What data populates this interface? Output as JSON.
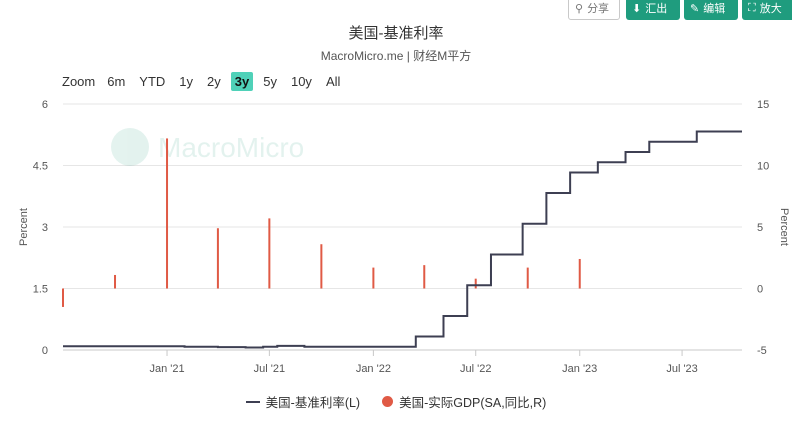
{
  "toolbar": {
    "share_label": "分享",
    "export_label": "汇出",
    "edit_label": "编辑",
    "zoom_label": "放大",
    "accent": "#1f9c7e"
  },
  "title": "美国-基准利率",
  "subtitle": "MacroMicro.me | 财经M平方",
  "watermark": "MacroMicro",
  "zoom": {
    "label": "Zoom",
    "options": [
      "6m",
      "YTD",
      "1y",
      "2y",
      "3y",
      "5y",
      "10y",
      "All"
    ],
    "active": "3y"
  },
  "chart_data": {
    "type": "line",
    "title": "美国-基准利率",
    "x_ticks": [
      "Jan '21",
      "Jul '21",
      "Jan '22",
      "Jul '22",
      "Jan '23",
      "Jul '23"
    ],
    "x_range": [
      "2020-07-01",
      "2023-10-15"
    ],
    "left_axis": {
      "label": "Percent",
      "ticks": [
        "0",
        "1.5",
        "3",
        "4.5",
        "6"
      ],
      "range": [
        0,
        6
      ]
    },
    "right_axis": {
      "label": "Percent",
      "ticks": [
        "-5",
        "0",
        "5",
        "10",
        "15"
      ],
      "range": [
        -5,
        15
      ]
    },
    "grid": true,
    "legend_position": "bottom",
    "series": [
      {
        "name": "美国-基准利率(L)",
        "type": "step-line",
        "axis": "left",
        "color": "#3d3f52",
        "points": [
          [
            "2020-07-01",
            0.09
          ],
          [
            "2020-10-01",
            0.09
          ],
          [
            "2020-12-01",
            0.09
          ],
          [
            "2021-02-01",
            0.08
          ],
          [
            "2021-04-01",
            0.07
          ],
          [
            "2021-05-20",
            0.06
          ],
          [
            "2021-06-20",
            0.08
          ],
          [
            "2021-07-15",
            0.1
          ],
          [
            "2021-09-01",
            0.08
          ],
          [
            "2021-11-01",
            0.08
          ],
          [
            "2022-01-01",
            0.08
          ],
          [
            "2022-03-17",
            0.33
          ],
          [
            "2022-05-05",
            0.83
          ],
          [
            "2022-06-16",
            1.58
          ],
          [
            "2022-07-28",
            2.33
          ],
          [
            "2022-09-22",
            3.08
          ],
          [
            "2022-11-03",
            3.83
          ],
          [
            "2022-12-15",
            4.33
          ],
          [
            "2023-02-02",
            4.58
          ],
          [
            "2023-03-23",
            4.83
          ],
          [
            "2023-05-04",
            5.08
          ],
          [
            "2023-07-27",
            5.33
          ],
          [
            "2023-10-15",
            5.33
          ]
        ]
      },
      {
        "name": "美国-实际GDP(SA,同比,R)",
        "type": "column",
        "axis": "right",
        "color": "#e05a45",
        "points": [
          [
            "2020-07-01",
            -1.5
          ],
          [
            "2020-10-01",
            1.1
          ],
          [
            "2021-01-01",
            12.2
          ],
          [
            "2021-04-01",
            4.9
          ],
          [
            "2021-07-01",
            5.7
          ],
          [
            "2021-10-01",
            3.6
          ],
          [
            "2022-01-01",
            1.7
          ],
          [
            "2022-04-01",
            1.9
          ],
          [
            "2022-07-01",
            0.8
          ],
          [
            "2022-10-01",
            1.7
          ],
          [
            "2023-01-01",
            2.4
          ]
        ]
      }
    ]
  }
}
